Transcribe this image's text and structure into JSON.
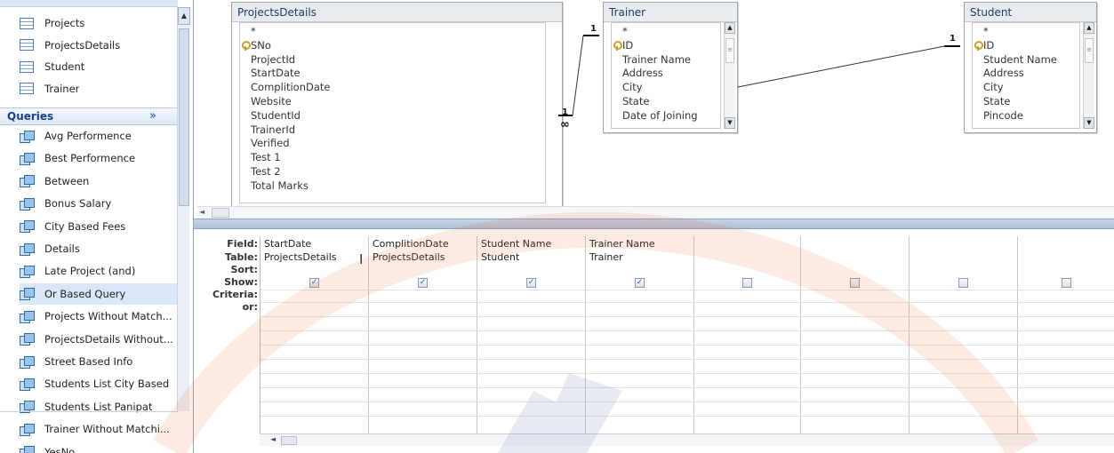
{
  "nav": {
    "tables": [
      {
        "label": "Projects"
      },
      {
        "label": "ProjectsDetails"
      },
      {
        "label": "Student"
      },
      {
        "label": "Trainer"
      }
    ],
    "queries_header": "Queries",
    "collapse_glyph": "»",
    "queries": [
      {
        "label": "Avg Performence"
      },
      {
        "label": "Best Performence"
      },
      {
        "label": "Between"
      },
      {
        "label": "Bonus Salary"
      },
      {
        "label": "City Based Fees"
      },
      {
        "label": "Details"
      },
      {
        "label": "Late Project (and)"
      },
      {
        "label": "Or Based Query",
        "selected": true
      },
      {
        "label": "Projects Without Match..."
      },
      {
        "label": "ProjectsDetails Without..."
      },
      {
        "label": "Street Based Info"
      },
      {
        "label": "Students List City Based"
      },
      {
        "label": "Students List Panipat"
      },
      {
        "label": "Trainer Without Matchi..."
      },
      {
        "label": "YesNo"
      }
    ]
  },
  "tables": {
    "projectsdetails": {
      "title": "ProjectsDetails",
      "fields": [
        "*",
        "SNo",
        "ProjectId",
        "StartDate",
        "ComplitionDate",
        "Website",
        "StudentId",
        "TrainerId",
        "Verified",
        "Test 1",
        "Test 2",
        "Total Marks"
      ]
    },
    "trainer": {
      "title": "Trainer",
      "fields": [
        "*",
        "ID",
        "Trainer Name",
        "Address",
        "City",
        "State",
        "Date of Joining"
      ]
    },
    "student": {
      "title": "Student",
      "fields": [
        "*",
        "ID",
        "Student Name",
        "Address",
        "City",
        "State",
        "Pincode"
      ]
    }
  },
  "relations": {
    "one": "1",
    "many": "∞"
  },
  "grid": {
    "row_labels": [
      "Field:",
      "Table:",
      "Sort:",
      "Show:",
      "Criteria:",
      "or:"
    ],
    "columns": [
      {
        "field": "StartDate",
        "table": "ProjectsDetails",
        "show": true
      },
      {
        "field": "ComplitionDate",
        "table": "ProjectsDetails",
        "show": true
      },
      {
        "field": "Student Name",
        "table": "Student",
        "show": true
      },
      {
        "field": "Trainer Name",
        "table": "Trainer",
        "show": true
      },
      {
        "field": "",
        "table": "",
        "show": false
      },
      {
        "field": "",
        "table": "",
        "show": false
      },
      {
        "field": "",
        "table": "",
        "show": false
      },
      {
        "field": "",
        "table": "",
        "show": false
      }
    ]
  },
  "icons": {
    "table": "table-icon",
    "query": "query-icon",
    "key": "primary-key-icon",
    "check": "✓",
    "left_arrow": "◄",
    "up_arrow": "▲",
    "down_arrow": "▼",
    "text_cursor": "I"
  },
  "colors": {
    "accent": "#15428b",
    "selection": "#d9e7f8",
    "watermark": "#e3571b"
  }
}
